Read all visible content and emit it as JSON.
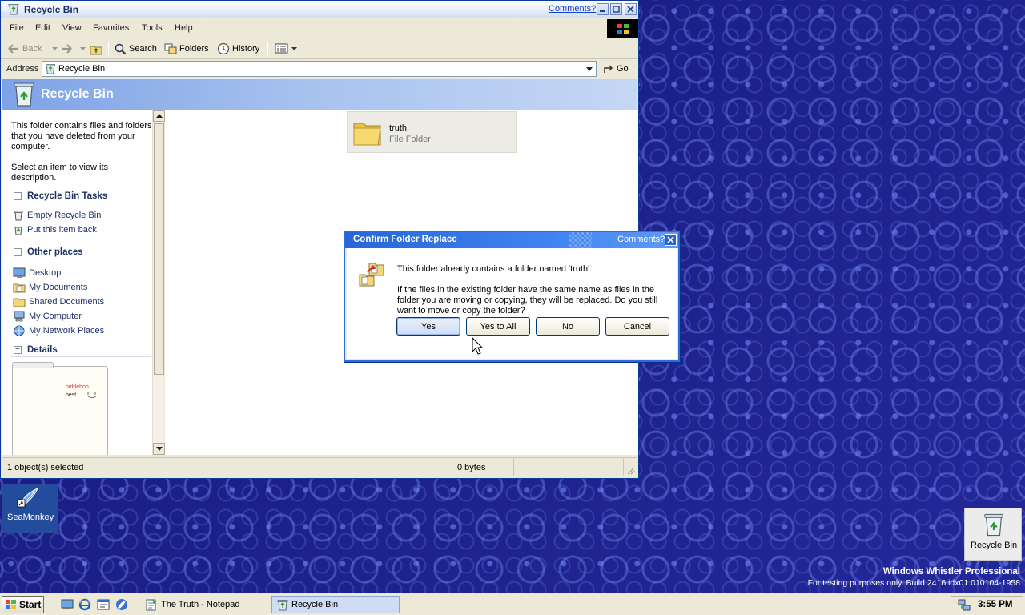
{
  "explorer": {
    "title": "Recycle Bin",
    "comments_link": "Comments?",
    "menu": [
      "File",
      "Edit",
      "View",
      "Favorites",
      "Tools",
      "Help"
    ],
    "toolbar": {
      "back": "Back",
      "search": "Search",
      "folders": "Folders",
      "history": "History"
    },
    "address": {
      "label": "Address",
      "value": "Recycle Bin",
      "go": "Go"
    },
    "banner_title": "Recycle Bin",
    "left_pane": {
      "intro": "This folder contains files and folders that you have deleted from your computer.",
      "select_hint": "Select an item to view its description.",
      "tasks_title": "Recycle Bin Tasks",
      "tasks": [
        "Empty Recycle Bin",
        "Put this item back"
      ],
      "places_title": "Other places",
      "places": [
        "Desktop",
        "My Documents",
        "Shared Documents",
        "My Computer",
        "My Network Places"
      ],
      "details_title": "Details",
      "preview_text": {
        "red": "hiddeboo",
        "black": "best"
      }
    },
    "items": [
      {
        "name": "truth",
        "type": "File Folder"
      }
    ],
    "status": {
      "selection": "1 object(s) selected",
      "size": "0 bytes"
    }
  },
  "dialog": {
    "title": "Confirm Folder Replace",
    "comments_link": "Comments?",
    "message1": "This folder already contains a folder named 'truth'.",
    "message2": "If the files in the existing folder have the same name as files in the folder you are moving or copying, they will be replaced.  Do you still want to move or copy the folder?",
    "buttons": {
      "yes": "Yes",
      "yes_all": "Yes to All",
      "no": "No",
      "cancel": "Cancel"
    }
  },
  "desktop": {
    "icons": [
      {
        "label": "SeaMonkey",
        "icon": "seamonkey-icon"
      },
      {
        "label": "Recycle Bin",
        "icon": "recycle-bin-icon"
      }
    ],
    "watermark_line1": "Windows Whistler Professional",
    "watermark_line2": "For testing purposes only. Build 2416.idx01.010104-1958"
  },
  "taskbar": {
    "start_label": "Start",
    "tasks": [
      {
        "label": "The Truth - Notepad",
        "active": false
      },
      {
        "label": "Recycle Bin",
        "active": true
      }
    ],
    "clock": "3:55 PM"
  },
  "colors": {
    "desktop_bg": "#1b1f88",
    "dialog_title": "#2766d8",
    "banner": "#7da2e6",
    "link": "#1440c8"
  }
}
